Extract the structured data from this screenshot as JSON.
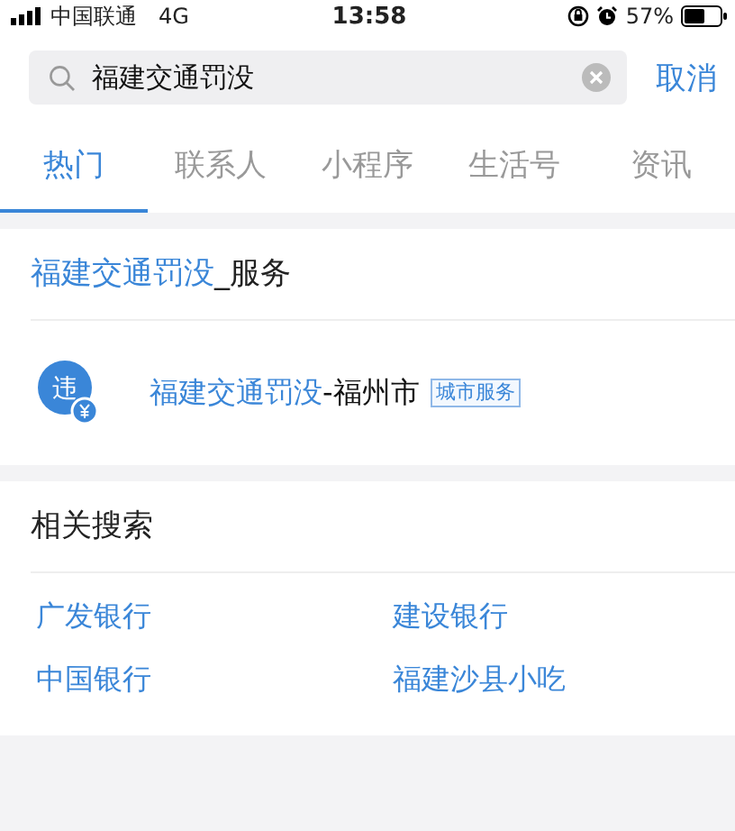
{
  "status_bar": {
    "carrier": "中国联通",
    "network": "4G",
    "time": "13:58",
    "battery": "57%"
  },
  "search": {
    "value": "福建交通罚没",
    "cancel": "取消"
  },
  "tabs": [
    {
      "label": "热门",
      "selected": true
    },
    {
      "label": "联系人",
      "selected": false
    },
    {
      "label": "小程序",
      "selected": false
    },
    {
      "label": "生活号",
      "selected": false
    },
    {
      "label": "资讯",
      "selected": false
    }
  ],
  "service_section": {
    "title_match": "福建交通罚没",
    "title_rest": "_服务",
    "item": {
      "icon_label": "违",
      "name_match": "福建交通罚没",
      "name_rest": "-福州市",
      "tag": "城市服务"
    }
  },
  "related_searches": {
    "title": "相关搜索",
    "items": [
      "广发银行",
      "建设银行",
      "中国银行",
      "福建沙县小吃"
    ]
  }
}
